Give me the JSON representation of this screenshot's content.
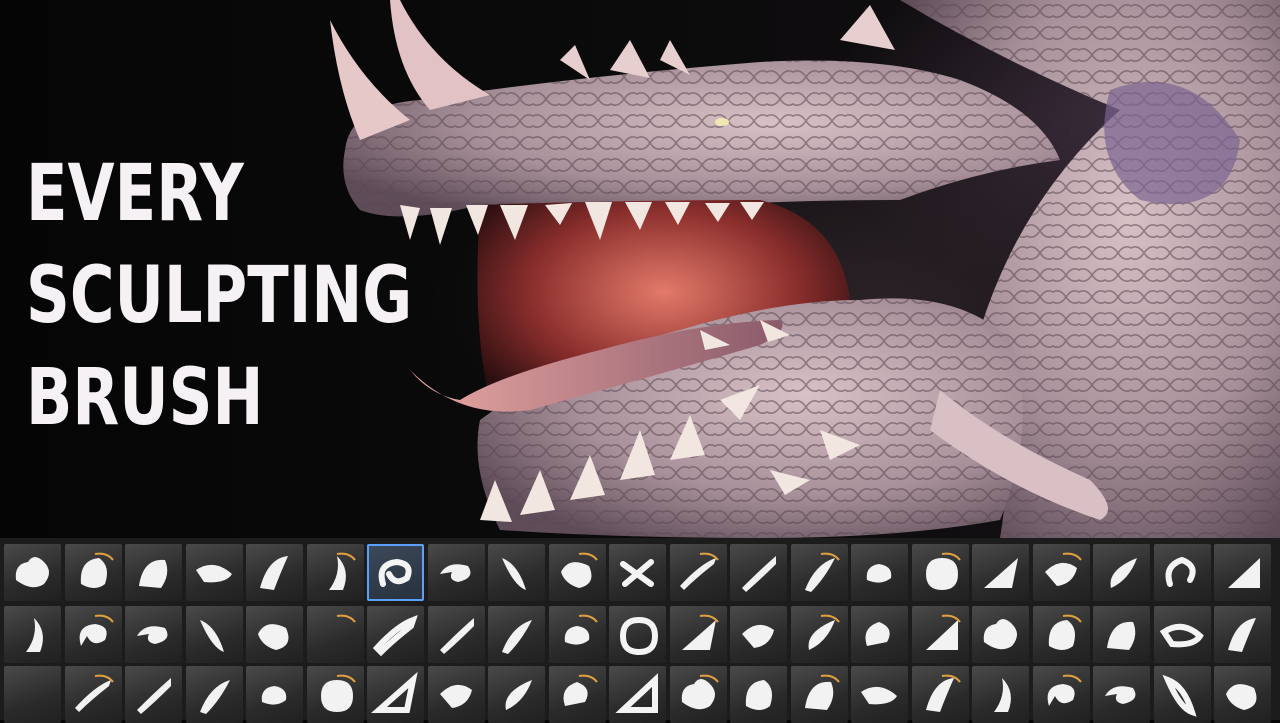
{
  "headline": {
    "lines": [
      "EVERY",
      "SCULPTING",
      "BRUSH"
    ]
  },
  "palette": {
    "selected_index": 6,
    "rows": [
      [
        "clay-buildup-icon",
        "blob-icon",
        "clay-tubes-icon",
        "smooth-stroke-icon",
        "standard-icon",
        "flatten-icon",
        "snake-hook-icon",
        "inflate-swirl-icon",
        "pinch-icon",
        "move-icon",
        "crease-x-icon",
        "slash-icon",
        "dam-standard-icon",
        "trim-icon",
        "nanomesh-icon",
        "layer-icon",
        "planar-icon",
        "rotate-ring-icon",
        "drop-icon",
        "curve-hook-icon",
        "triangle-icon"
      ],
      [
        "insert-spin-icon",
        "horn-icon",
        "curve-tube-icon",
        "morph-icon",
        "stitch-icon",
        "wave-icon",
        "mesh-grid-icon",
        "mesh-box-icon",
        "curl-icon",
        "mask-pen-icon",
        "twist-icon",
        "polygroup-sphere-icon",
        "striped-sphere-icon",
        "color-sphere-icon",
        "outline-icon",
        "soft-ramp-icon",
        "smear-icon",
        "soft-glow-icon",
        "glow-ramp-icon",
        "glow-spot-icon",
        "glow-edge-icon"
      ],
      [
        "scribble-icon",
        "signature-icon",
        "wavy-line-icon",
        "zigzag-icon",
        "blocky-icon",
        "flat-curve-icon",
        "dome-icon",
        "spiky-ball-icon",
        "arc-stroke-icon",
        "fold-icon",
        "scratch-icon",
        "fur-icon",
        "fan-icon",
        "pinch-tool-icon",
        "spray-icon",
        "leaf-icon",
        "sparkle-icon",
        "burst-icon",
        "flower-icon",
        "hook-blade-icon",
        "gem-icon"
      ]
    ]
  },
  "colors": {
    "selected_border": "#5aa0ff",
    "text": "#f5f1f5"
  }
}
